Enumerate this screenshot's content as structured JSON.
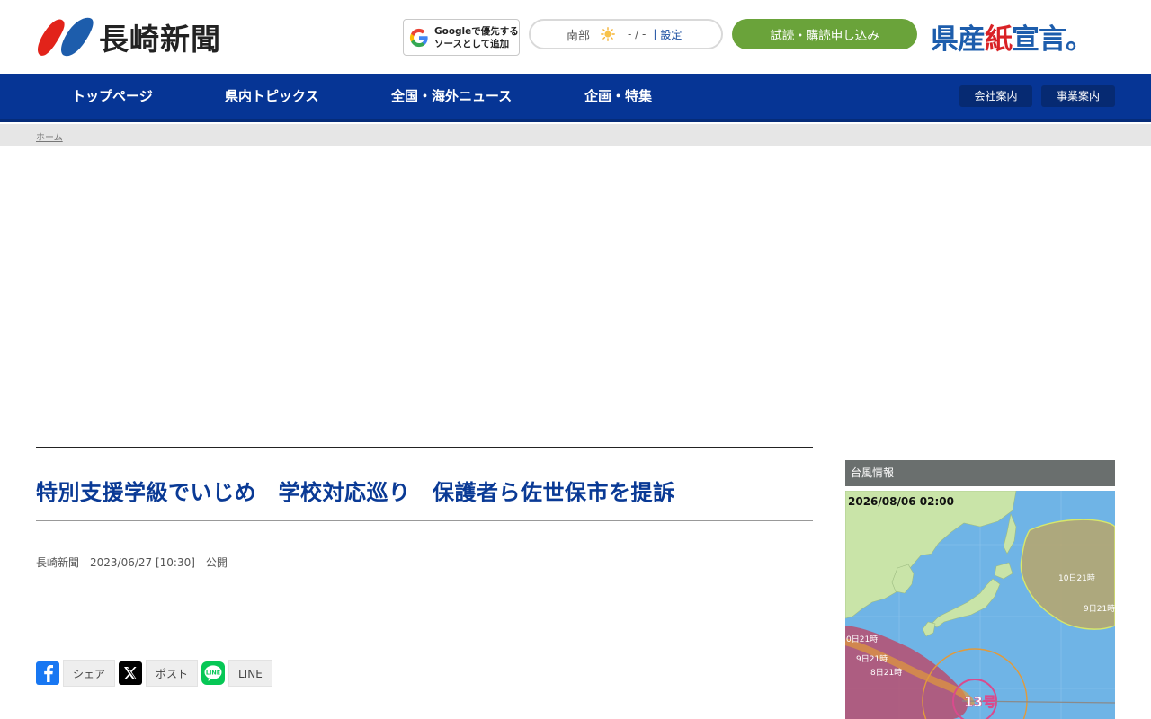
{
  "header": {
    "logo_text": "長崎新聞",
    "google_button": {
      "line1": "Googleで優先する",
      "line2": "ソースとして追加",
      "icon": "google-g-icon"
    },
    "weather": {
      "region": "南部",
      "icon": "sun-icon",
      "temperature": "- / -",
      "separator": "|",
      "setting_label": "設定"
    },
    "subscribe_label": "試読・購読申し込み",
    "kensan": {
      "part1": "県産",
      "part2": "紙",
      "part3": "宣言。"
    }
  },
  "nav": {
    "items": [
      {
        "label": "トップページ"
      },
      {
        "label": "県内トピックス"
      },
      {
        "label": "全国・海外ニュース"
      },
      {
        "label": "企画・特集"
      }
    ],
    "buttons": [
      {
        "label": "会社案内"
      },
      {
        "label": "事業案内"
      }
    ]
  },
  "breadcrumb": {
    "home": "ホーム"
  },
  "article": {
    "title": "特別支援学級でいじめ　学校対応巡り　保護者ら佐世保市を提訴",
    "meta": "長崎新聞　2023/06/27 [10:30]　公開"
  },
  "share": {
    "facebook": "シェア",
    "x": "ポスト",
    "line": "LINE",
    "colors": {
      "facebook": "#1877f2",
      "x": "#000000",
      "line": "#06c755"
    }
  },
  "sidebar": {
    "typhoon_heading": "台風情報",
    "typhoon_map": {
      "timestamp": "2026/08/06 02:00",
      "labels": [
        "10日21時",
        "9日21時",
        "0日21時",
        "9日21時",
        "8日21時"
      ],
      "typhoon_number": "13号"
    }
  },
  "colors": {
    "nav_bg": "#063595",
    "title": "#0a3a95",
    "subscribe": "#6aa33a",
    "kensan_blue": "#1d5dac",
    "kensan_red": "#d92226"
  }
}
